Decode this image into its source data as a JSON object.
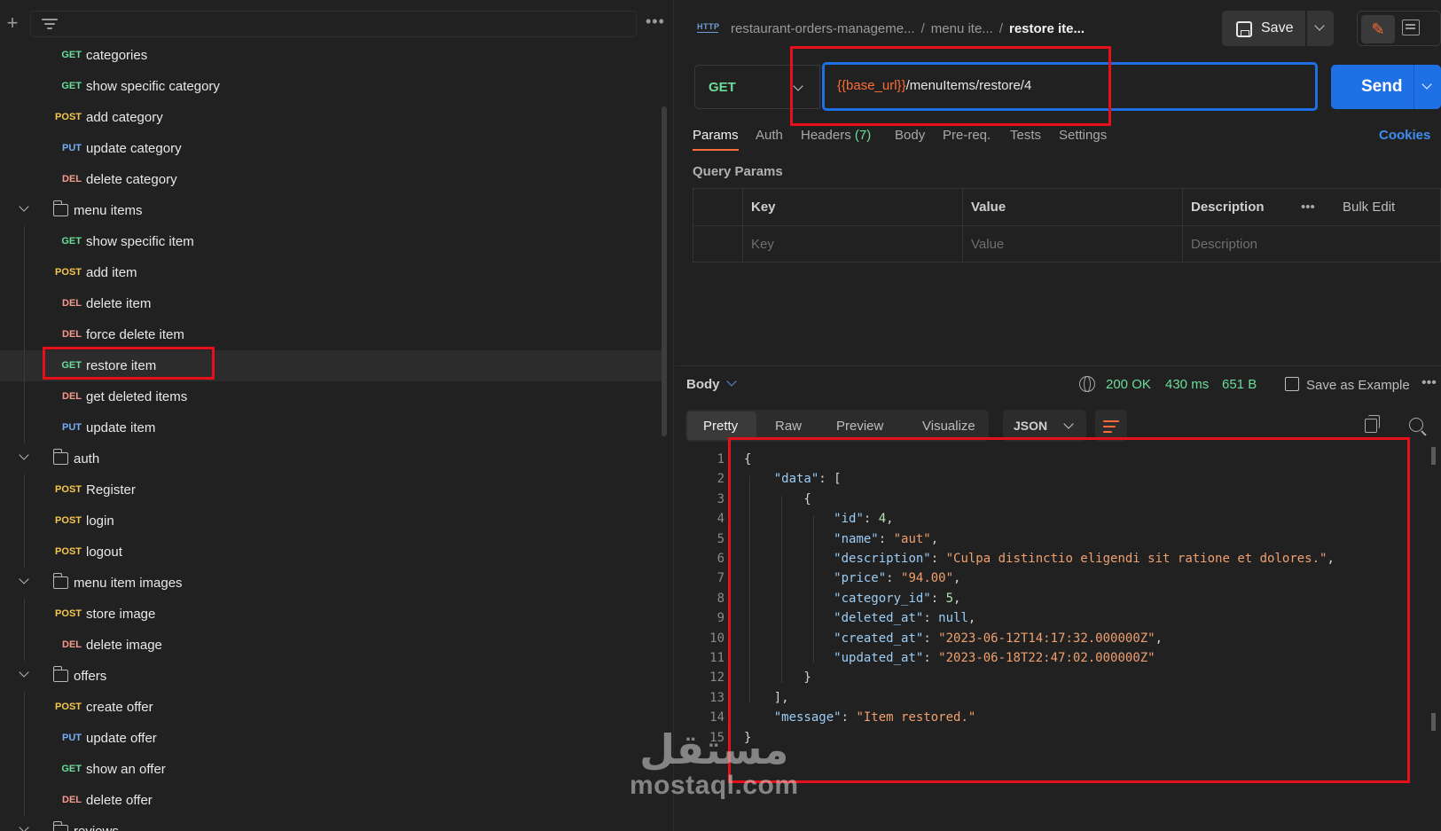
{
  "sidebar": {
    "more_label": "•••",
    "items": [
      {
        "method": "GET",
        "label": "categories"
      },
      {
        "method": "GET",
        "label": "show specific category"
      },
      {
        "method": "POST",
        "label": "add category"
      },
      {
        "method": "PUT",
        "label": "update category"
      },
      {
        "method": "DEL",
        "label": "delete category"
      },
      {
        "folder": "menu items"
      },
      {
        "method": "GET",
        "label": "show specific item"
      },
      {
        "method": "POST",
        "label": "add item"
      },
      {
        "method": "DEL",
        "label": "delete item"
      },
      {
        "method": "DEL",
        "label": "force delete item"
      },
      {
        "method": "GET",
        "label": "restore item",
        "selected": true
      },
      {
        "method": "DEL",
        "label": "get deleted items"
      },
      {
        "method": "PUT",
        "label": "update item"
      },
      {
        "folder": "auth"
      },
      {
        "method": "POST",
        "label": "Register"
      },
      {
        "method": "POST",
        "label": "login"
      },
      {
        "method": "POST",
        "label": "logout"
      },
      {
        "folder": "menu item images"
      },
      {
        "method": "POST",
        "label": "store image"
      },
      {
        "method": "DEL",
        "label": "delete image"
      },
      {
        "folder": "offers"
      },
      {
        "method": "POST",
        "label": "create offer"
      },
      {
        "method": "PUT",
        "label": "update offer"
      },
      {
        "method": "GET",
        "label": "show an offer"
      },
      {
        "method": "DEL",
        "label": "delete offer"
      },
      {
        "folder": "reviews"
      }
    ]
  },
  "header": {
    "http_icon_label": "HTTP",
    "breadcrumb": [
      "restaurant-orders-manageme...",
      "menu ite...",
      "restore ite..."
    ],
    "save_label": "Save"
  },
  "request": {
    "method": "GET",
    "url_variable": "{{base_url}}",
    "url_path": "/menuItems/restore/4",
    "send_label": "Send",
    "tabs": [
      "Params",
      "Auth",
      "Headers",
      "Body",
      "Pre-req.",
      "Tests",
      "Settings"
    ],
    "headers_count": "(7)",
    "cookies_label": "Cookies",
    "query_params_title": "Query Params",
    "table": {
      "headers": [
        "Key",
        "Value",
        "Description"
      ],
      "placeholders": [
        "Key",
        "Value",
        "Description"
      ],
      "more_label": "•••",
      "bulk_edit_label": "Bulk Edit"
    }
  },
  "response": {
    "body_label": "Body",
    "status": "200 OK",
    "time": "430 ms",
    "size": "651 B",
    "save_example_label": "Save as Example",
    "more_label": "•••",
    "format_tabs": [
      "Pretty",
      "Raw",
      "Preview",
      "Visualize"
    ],
    "language": "JSON",
    "lines": [
      {
        "n": "1",
        "text": "{"
      },
      {
        "n": "2",
        "text": "    \"data\": ["
      },
      {
        "n": "3",
        "text": "        {"
      },
      {
        "n": "4",
        "text": "            \"id\": 4,"
      },
      {
        "n": "5",
        "text": "            \"name\": \"aut\","
      },
      {
        "n": "6",
        "text": "            \"description\": \"Culpa distinctio eligendi sit ratione et dolores.\","
      },
      {
        "n": "7",
        "text": "            \"price\": \"94.00\","
      },
      {
        "n": "8",
        "text": "            \"category_id\": 5,"
      },
      {
        "n": "9",
        "text": "            \"deleted_at\": null,"
      },
      {
        "n": "10",
        "text": "            \"created_at\": \"2023-06-12T14:17:32.000000Z\","
      },
      {
        "n": "11",
        "text": "            \"updated_at\": \"2023-06-18T22:47:02.000000Z\""
      },
      {
        "n": "12",
        "text": "        }"
      },
      {
        "n": "13",
        "text": "    ],"
      },
      {
        "n": "14",
        "text": "    \"message\": \"Item restored.\""
      },
      {
        "n": "15",
        "text": "}"
      }
    ]
  },
  "watermark": {
    "arabic": "مستقل",
    "latin": "mostaql.com"
  },
  "colors": {
    "accent": "#ff6c37",
    "primary": "#1f6fe5",
    "get": "#6bdd9a",
    "post": "#f5c84c",
    "put": "#74aef6",
    "del": "#f79a8e",
    "annotation": "#e5101a"
  }
}
